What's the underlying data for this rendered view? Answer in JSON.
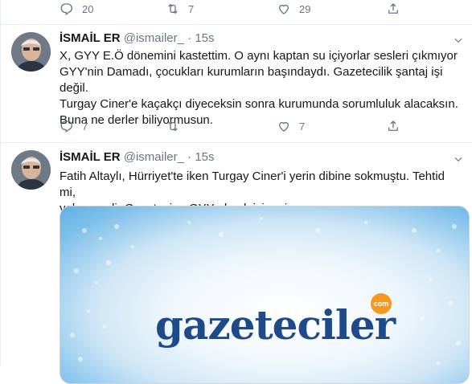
{
  "top_actions": {
    "reply_count": "20",
    "retweet_count": "7",
    "like_count": "29"
  },
  "tweets": [
    {
      "name": "İSMAİL ER",
      "handle": "@ismailer_",
      "dot": "·",
      "time": "15s",
      "text_lines": [
        "X, GYY E.Ö dönemini kastettim. O aynı kaptan su içiyorlar sesleri çıkmıyor",
        "GYY'nin Damadı, çocukları kurumların başındaydı. Gazetecilik şantaj işi değil.",
        "Turgay Ciner'e kaçakçı diyeceksin sonra kurumunda sorumluluk alacaksın.",
        "Buna ne derler biliyormusun."
      ],
      "reply_count": "7",
      "retweet_count": "",
      "like_count": "7"
    },
    {
      "name": "İSMAİL ER",
      "handle": "@ismailer_",
      "dot": "·",
      "time": "15s",
      "text_lines": [
        "Fatih Altaylı, Hürriyet'te iken Turgay Ciner'i yerin dibine sokmuştu. Tehtid mi,",
        "yoksa nedir Gazetesine GYY olmak için mi."
      ],
      "card": {
        "logo_text": "gazeteciler",
        "badge_text": "com"
      }
    }
  ],
  "icons": {
    "reply": "reply-icon",
    "retweet": "retweet-icon",
    "like": "like-icon",
    "share": "share-icon",
    "more": "chevron-down-icon"
  },
  "colors": {
    "text": "#14171a",
    "muted": "#657786",
    "divider": "#e6ecf0",
    "logo": "#1e4a8a",
    "badge": "#f39a1e"
  }
}
